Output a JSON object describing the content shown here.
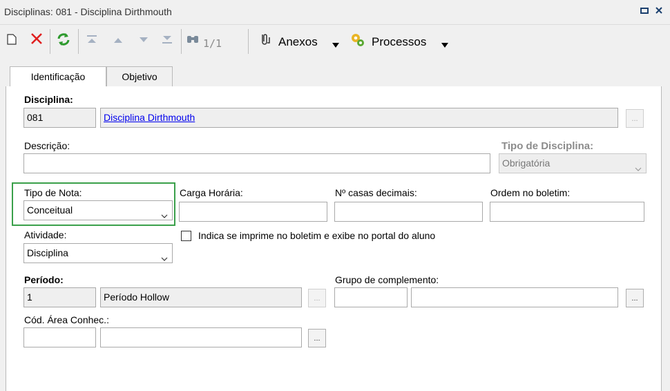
{
  "window": {
    "title": "Disciplinas: 081 - Disciplina Dirthmouth"
  },
  "toolbar": {
    "record_counter": "1/1",
    "anexos_label": "Anexos",
    "processos_label": "Processos"
  },
  "tabs": [
    {
      "label": "Identificação"
    },
    {
      "label": "Objetivo"
    }
  ],
  "form": {
    "disciplina": {
      "label": "Disciplina:",
      "code": "081",
      "name": "Disciplina Dirthmouth"
    },
    "descricao": {
      "label": "Descrição:",
      "value": ""
    },
    "tipo_disciplina": {
      "label": "Tipo de Disciplina:",
      "value": "Obrigatória"
    },
    "tipo_nota": {
      "label": "Tipo de Nota:",
      "value": "Conceitual"
    },
    "carga_horaria": {
      "label": "Carga Horária:",
      "value": ""
    },
    "casas_decimais": {
      "label": "Nº casas decimais:",
      "value": ""
    },
    "ordem_boletim": {
      "label": "Ordem no boletim:",
      "value": ""
    },
    "atividade": {
      "label": "Atividade:",
      "value": "Disciplina"
    },
    "imprime_boletim": {
      "label": "Indica se imprime no boletim e exibe no portal do aluno",
      "checked": false
    },
    "periodo": {
      "label": "Período:",
      "code": "1",
      "name": "Período Hollow"
    },
    "grupo_complemento": {
      "label": "Grupo de complemento:",
      "code": "",
      "name": ""
    },
    "cod_area": {
      "label": "Cód. Área Conhec.:",
      "code": "",
      "name": ""
    },
    "lookup_button": "..."
  },
  "colors": {
    "accent_focus": "#3aa04a",
    "link": "#0000ee",
    "delete_red": "#e02020",
    "refresh_green": "#2e9a2e"
  }
}
